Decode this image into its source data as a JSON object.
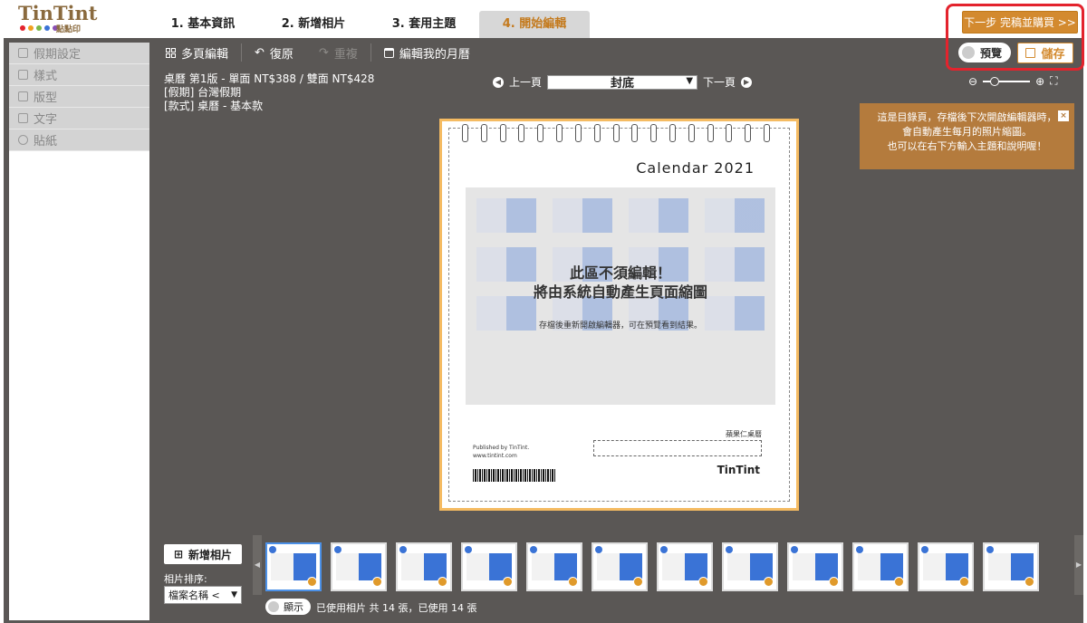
{
  "brand": {
    "name": "TinTint",
    "sub": "點點印",
    "dot_colors": [
      "#e3232d",
      "#f0a020",
      "#7ab84a",
      "#3a73d6",
      "#8a4fb3"
    ]
  },
  "steps": [
    {
      "label": "1. 基本資訊"
    },
    {
      "label": "2. 新增相片"
    },
    {
      "label": "3. 套用主題"
    },
    {
      "label": "4. 開始編輯"
    }
  ],
  "next_button": "下一步 完稿並購買 >>",
  "sidebar": {
    "items": [
      {
        "label": "假期設定"
      },
      {
        "label": "樣式"
      },
      {
        "label": "版型"
      },
      {
        "label": "文字"
      },
      {
        "label": "貼紙"
      }
    ]
  },
  "toolbar": {
    "multi_page": "多頁編輯",
    "undo": "復原",
    "redo": "重複",
    "edit_calendar": "編輯我的月曆",
    "preview": "預覽",
    "save": "儲存"
  },
  "info": {
    "line1": "桌曆 第1版 - 單面 NT$388 / 雙面 NT$428",
    "line2": "[假期] 台灣假期",
    "line3": "[款式] 桌曆 - 基本款"
  },
  "pager": {
    "prev": "上一頁",
    "current": "封底",
    "next": "下一頁"
  },
  "tooltip": {
    "line1": "這是目錄頁，存檔後下次開啟編輯器時，",
    "line2": "會自動產生每月的照片縮圖。",
    "line3": "也可以在右下方輸入主題和說明喔！",
    "close": "×"
  },
  "page": {
    "title": "Calendar  2021",
    "notice_line1": "此區不須編輯！",
    "notice_line2": "將由系統自動產生頁面縮圖",
    "notice_sub": "存檔後重新開啟編輯器，可在預覽看到結果。",
    "published_by": "Published by TinTint.",
    "website": "www.tintint.com",
    "owner": "蘋果仁桌曆",
    "logo": "TinTint"
  },
  "bottom": {
    "add_photo": "新增相片",
    "sort_label": "相片排序:",
    "sort_value": "檔案名稱 <",
    "show_toggle": "顯示",
    "status": "已使用相片   共 14 張，已使用 14 張"
  }
}
